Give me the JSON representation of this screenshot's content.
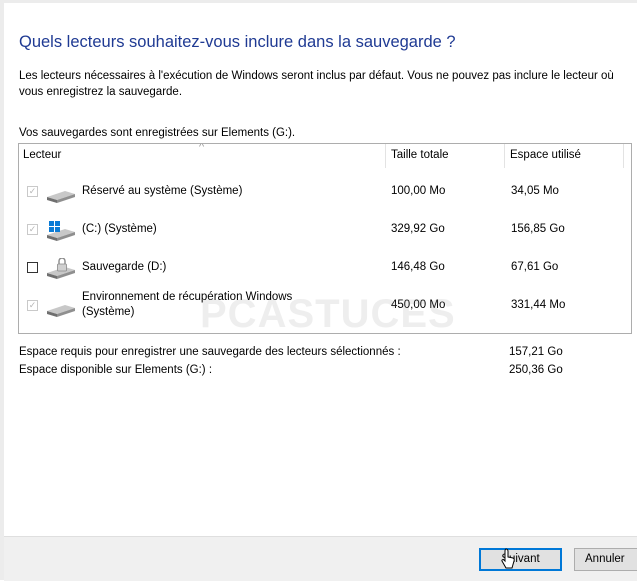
{
  "dialog": {
    "title": "Quels lecteurs souhaitez-vous inclure dans la sauvegarde ?",
    "intro": "Les lecteurs nécessaires à l'exécution de Windows seront inclus par défaut. Vous ne pouvez pas inclure le lecteur où vous enregistrez la sauvegarde.",
    "location": "Vos sauvegardes sont enregistrées sur Elements (G:)."
  },
  "table": {
    "columns": {
      "drive": "Lecteur",
      "total": "Taille totale",
      "used": "Espace utilisé"
    },
    "sort_indicator": "^",
    "rows": [
      {
        "name": "Réservé au système (Système)",
        "name_line2": "",
        "total": "100,00 Mo",
        "used": "34,05 Mo",
        "checked": true,
        "disabled": true,
        "icon": "hard-drive-icon"
      },
      {
        "name": "(C:) (Système)",
        "name_line2": "",
        "total": "329,92 Go",
        "used": "156,85 Go",
        "checked": true,
        "disabled": true,
        "icon": "windows-drive-icon"
      },
      {
        "name": "Sauvegarde (D:)",
        "name_line2": "",
        "total": "146,48 Go",
        "used": "67,61 Go",
        "checked": false,
        "disabled": false,
        "icon": "locked-drive-icon"
      },
      {
        "name": "Environnement de récupération Windows",
        "name_line2": "(Système)",
        "total": "450,00 Mo",
        "used": "331,44 Mo",
        "checked": true,
        "disabled": true,
        "icon": "hard-drive-icon"
      }
    ]
  },
  "summary": {
    "required_label": "Espace requis pour enregistrer une sauvegarde des lecteurs sélectionnés :",
    "required_value": "157,21 Go",
    "available_label": "Espace disponible sur Elements (G:) :",
    "available_value": "250,36 Go"
  },
  "watermark": "PCASTUCES",
  "buttons": {
    "next": "Suivant",
    "cancel": "Annuler"
  },
  "colors": {
    "title": "#1f3a93",
    "primary_border": "#0078d7",
    "footer_bg": "#f0f0f0"
  }
}
